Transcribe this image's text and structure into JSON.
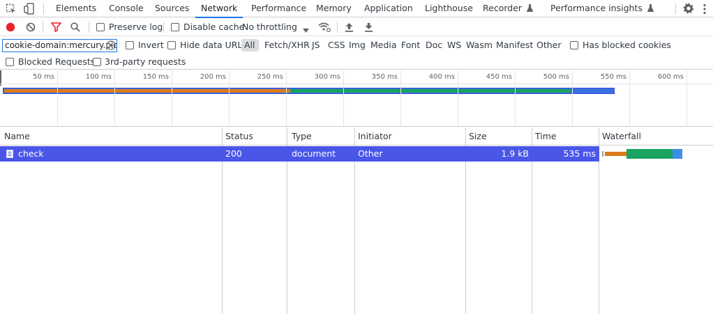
{
  "tabs": [
    {
      "label": "Elements"
    },
    {
      "label": "Console"
    },
    {
      "label": "Sources"
    },
    {
      "label": "Network",
      "active": true
    },
    {
      "label": "Performance"
    },
    {
      "label": "Memory"
    },
    {
      "label": "Application"
    },
    {
      "label": "Lighthouse"
    },
    {
      "label": "Recorder"
    },
    {
      "label": "Performance insights"
    }
  ],
  "toolbar": {
    "preserve_log": "Preserve log",
    "disable_cache": "Disable cache",
    "throttling": "No throttling"
  },
  "filter": {
    "value": "cookie-domain:mercury.pic",
    "invert": "Invert",
    "hide_data_urls": "Hide data URLs",
    "types": [
      "All",
      "Fetch/XHR",
      "JS",
      "CSS",
      "Img",
      "Media",
      "Font",
      "Doc",
      "WS",
      "Wasm",
      "Manifest",
      "Other"
    ],
    "has_blocked_cookies": "Has blocked cookies",
    "blocked_requests": "Blocked Requests",
    "third_party": "3rd-party requests"
  },
  "overview": {
    "ticks": [
      "50 ms",
      "100 ms",
      "150 ms",
      "200 ms",
      "250 ms",
      "300 ms",
      "350 ms",
      "400 ms",
      "450 ms",
      "500 ms",
      "550 ms",
      "600 ms"
    ],
    "timing_ms": {
      "waiting_end": 250,
      "download_end": 495,
      "total": 535
    }
  },
  "table": {
    "columns": [
      "Name",
      "Status",
      "Type",
      "Initiator",
      "Size",
      "Time",
      "Waterfall"
    ],
    "rows": [
      {
        "name": "check",
        "status": "200",
        "type": "document",
        "initiator": "Other",
        "size": "1.9 kB",
        "time": "535 ms"
      }
    ]
  },
  "colors": {
    "accent": "#1a73e8",
    "record": "#e8212c",
    "waiting": "#dc7a1a",
    "download": "#1aa260",
    "selected_row": "#4a56e8",
    "overview_border": "#3050d8"
  }
}
